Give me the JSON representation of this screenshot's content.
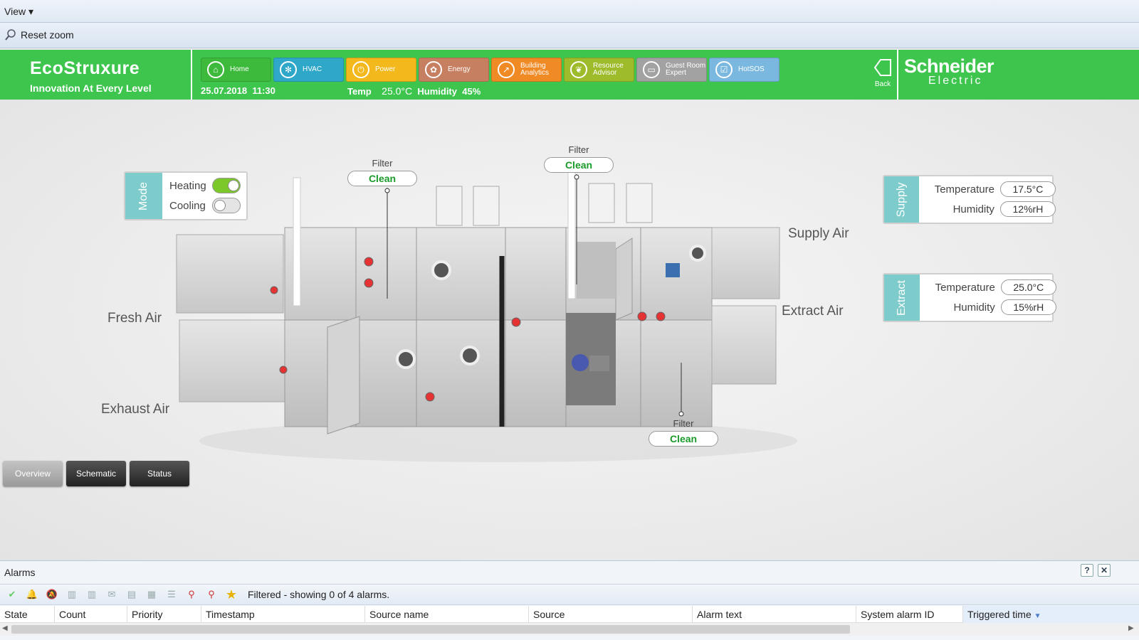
{
  "menu": {
    "view_label": "View"
  },
  "toolbar": {
    "reset_zoom": "Reset zoom"
  },
  "brand": {
    "title": "EcoStruxure",
    "tagline": "Innovation At Every Level",
    "partner_line1": "Schneider",
    "partner_line2": "Electric"
  },
  "nav": {
    "items": [
      {
        "label": "Home",
        "color": "#3dba3c"
      },
      {
        "label": "HVAC",
        "color": "#2ea7c9"
      },
      {
        "label": "Power",
        "color": "#f2b81c"
      },
      {
        "label": "Energy",
        "color": "#c77f62"
      },
      {
        "label": "Building Analytics",
        "color": "#f08a25"
      },
      {
        "label": "Resource Advisor",
        "color": "#9dbb2a"
      },
      {
        "label": "Guest Room Expert",
        "color": "#a2a2a2"
      },
      {
        "label": "HotSOS",
        "color": "#7ab8e0"
      }
    ],
    "back_label": "Back"
  },
  "info": {
    "date": "25.07.2018",
    "time": "11:30",
    "temp_label": "Temp",
    "temp_value": "25.0°C",
    "humidity_label": "Humidity",
    "humidity_value": "45%"
  },
  "mode": {
    "tab": "Mode",
    "heating_label": "Heating",
    "heating_on": true,
    "cooling_label": "Cooling",
    "cooling_on": false
  },
  "supply": {
    "tab": "Supply",
    "temp_label": "Temperature",
    "temp_value": "17.5°C",
    "hum_label": "Humidity",
    "hum_value": "12%rH"
  },
  "extract": {
    "tab": "Extract",
    "temp_label": "Temperature",
    "temp_value": "25.0°C",
    "hum_label": "Humidity",
    "hum_value": "15%rH"
  },
  "labels": {
    "fresh_air": "Fresh Air",
    "exhaust_air": "Exhaust Air",
    "supply_air": "Supply Air",
    "extract_air": "Extract Air"
  },
  "filters": [
    {
      "title": "Filter",
      "status": "Clean"
    },
    {
      "title": "Filter",
      "status": "Clean"
    },
    {
      "title": "Filter",
      "status": "Clean"
    }
  ],
  "views": {
    "overview": "Overview",
    "schematic": "Schematic",
    "status": "Status"
  },
  "alarms": {
    "title": "Alarms",
    "filter_text": "Filtered - showing 0 of 4 alarms.",
    "columns": [
      "State",
      "Count",
      "Priority",
      "Timestamp",
      "Source name",
      "Source",
      "Alarm text",
      "System alarm ID",
      "Triggered time"
    ]
  }
}
